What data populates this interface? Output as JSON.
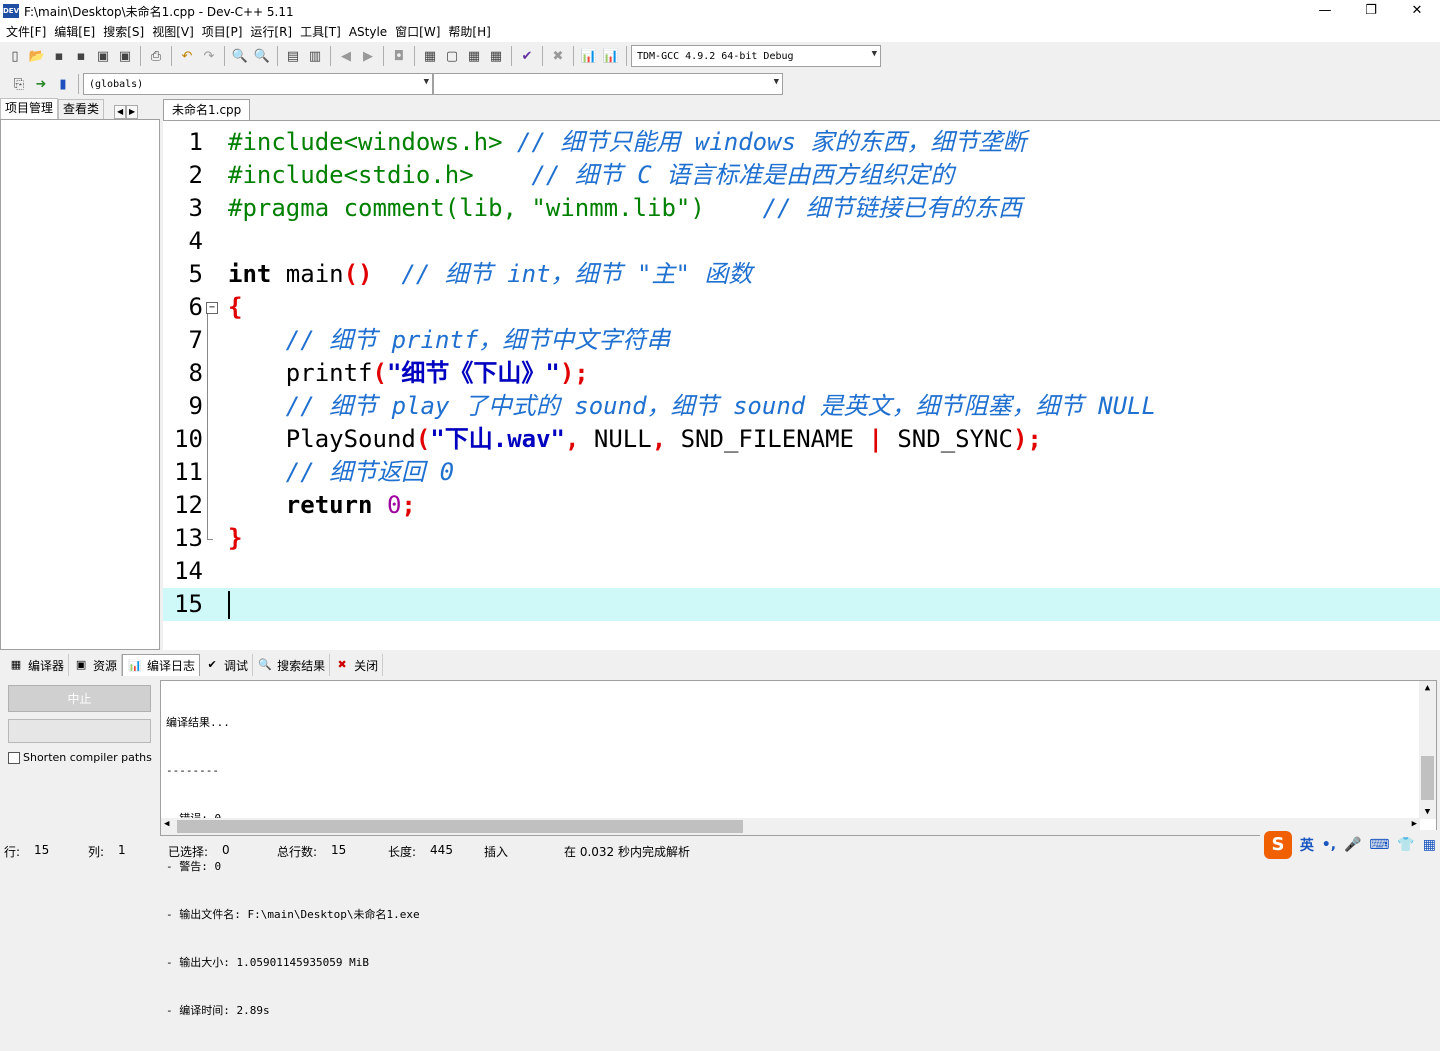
{
  "window": {
    "title": "F:\\main\\Desktop\\未命名1.cpp - Dev-C++ 5.11",
    "app_icon_text": "DEV"
  },
  "menu": [
    "文件[F]",
    "编辑[E]",
    "搜索[S]",
    "视图[V]",
    "项目[P]",
    "运行[R]",
    "工具[T]",
    "AStyle",
    "窗口[W]",
    "帮助[H]"
  ],
  "toolbar": {
    "compiler_select": "TDM-GCC 4.9.2 64-bit Debug",
    "scope_select": "(globals)",
    "symbol_select": ""
  },
  "left_panel": {
    "tabs": [
      "项目管理",
      "查看类"
    ]
  },
  "editor": {
    "tab": "未命名1.cpp",
    "line_numbers": [
      "1",
      "2",
      "3",
      "4",
      "5",
      "6",
      "7",
      "8",
      "9",
      "10",
      "11",
      "12",
      "13",
      "14",
      "15"
    ],
    "current_line": 15,
    "tokens": {
      "l1_pp": "#include<windows.h>",
      "l1_cm": " // 细节只能用 windows 家的东西，细节垄断",
      "l2_pp": "#include<stdio.h>   ",
      "l2_cm": " // 细节 C 语言标准是由西方组织定的",
      "l3_pp": "#pragma comment(lib, \"winmm.lib\")   ",
      "l3_cm": " // 细节链接已有的东西",
      "l5_kw": "int",
      "l5_id": " main",
      "l5_br": "()",
      "l5_cm": "  // 细节 int，细节 \"主\" 函数",
      "l6_br": "{",
      "l7_cm": "    // 细节 printf，细节中文字符串",
      "l8_id": "    printf",
      "l8_br1": "(",
      "l8_st": "\"细节《下山》\"",
      "l8_br2": ");",
      "l9_cm": "    // 细节 play 了中式的 sound，细节 sound 是英文，细节阻塞，细节 NULL",
      "l10_id": "    PlaySound",
      "l10_br1": "(",
      "l10_st": "\"下山.wav\"",
      "l10_br2": ",",
      "l10_id2": " NULL",
      "l10_br3": ",",
      "l10_id3": " SND_FILENAME ",
      "l10_br4": "|",
      "l10_id4": " SND_SYNC",
      "l10_br5": ");",
      "l11_cm": "    // 细节返回 0",
      "l12_kw": "    return",
      "l12_num": " 0",
      "l12_br": ";",
      "l13_br": "}"
    }
  },
  "bottom_tabs": [
    "编译器",
    "资源",
    "编译日志",
    "调试",
    "搜索结果",
    "关闭"
  ],
  "compile_panel": {
    "stop_button": "中止",
    "shorten_paths_label": "Shorten compiler paths",
    "log": [
      "编译结果...",
      "--------",
      "- 错误: 0",
      "- 警告: 0",
      "- 输出文件名: F:\\main\\Desktop\\未命名1.exe",
      "- 输出大小: 1.05901145935059 MiB",
      "- 编译时间: 2.89s"
    ]
  },
  "status": {
    "row_label": "行:",
    "row_value": "15",
    "col_label": "列:",
    "col_value": "1",
    "sel_label": "已选择:",
    "sel_value": "0",
    "total_label": "总行数:",
    "total_value": "15",
    "len_label": "长度:",
    "len_value": "445",
    "mode": "插入",
    "parse": "在 0.032 秒内完成解析"
  },
  "tray": {
    "ime_logo": "S",
    "ime_lang": "英"
  }
}
